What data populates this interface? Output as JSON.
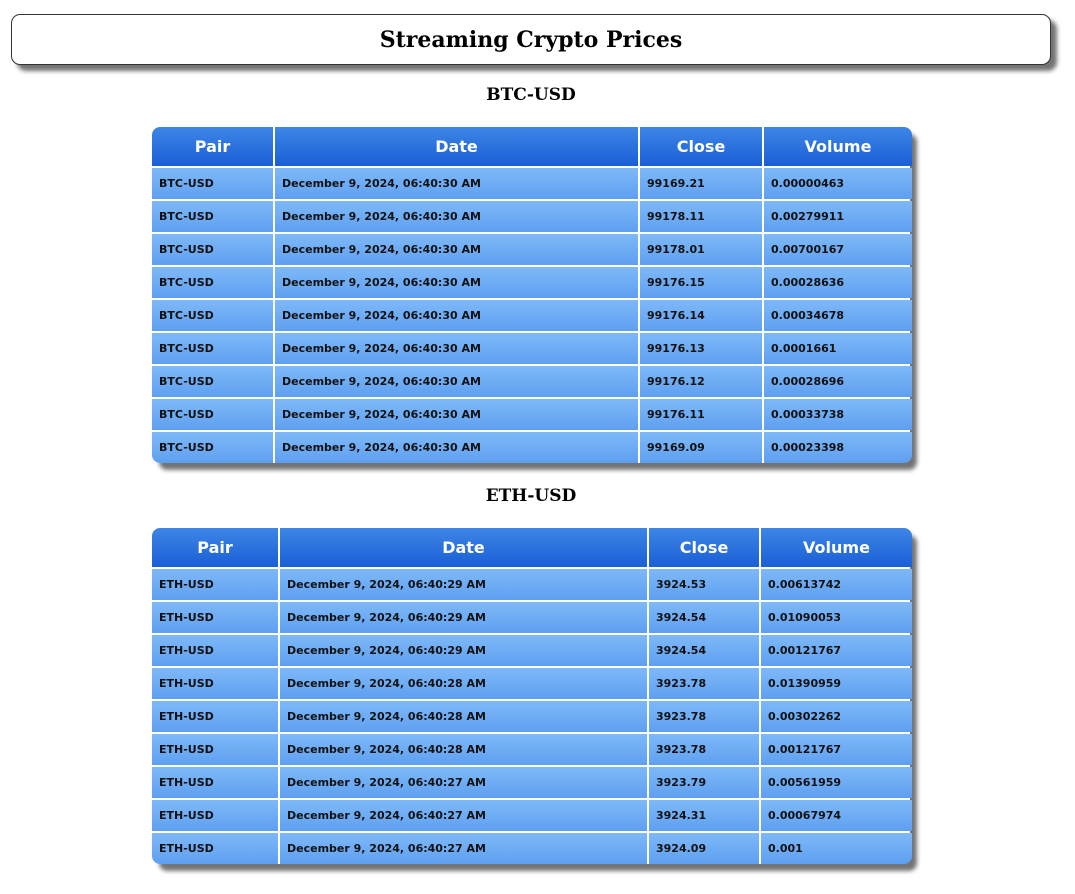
{
  "header": {
    "title": "Streaming Crypto Prices"
  },
  "columns": [
    "Pair",
    "Date",
    "Close",
    "Volume"
  ],
  "sections": [
    {
      "title": "BTC-USD",
      "rows": [
        [
          "BTC-USD",
          "December 9, 2024, 06:40:30 AM",
          "99169.21",
          "0.00000463"
        ],
        [
          "BTC-USD",
          "December 9, 2024, 06:40:30 AM",
          "99178.11",
          "0.00279911"
        ],
        [
          "BTC-USD",
          "December 9, 2024, 06:40:30 AM",
          "99178.01",
          "0.00700167"
        ],
        [
          "BTC-USD",
          "December 9, 2024, 06:40:30 AM",
          "99176.15",
          "0.00028636"
        ],
        [
          "BTC-USD",
          "December 9, 2024, 06:40:30 AM",
          "99176.14",
          "0.00034678"
        ],
        [
          "BTC-USD",
          "December 9, 2024, 06:40:30 AM",
          "99176.13",
          "0.0001661"
        ],
        [
          "BTC-USD",
          "December 9, 2024, 06:40:30 AM",
          "99176.12",
          "0.00028696"
        ],
        [
          "BTC-USD",
          "December 9, 2024, 06:40:30 AM",
          "99176.11",
          "0.00033738"
        ],
        [
          "BTC-USD",
          "December 9, 2024, 06:40:30 AM",
          "99169.09",
          "0.00023398"
        ]
      ]
    },
    {
      "title": "ETH-USD",
      "rows": [
        [
          "ETH-USD",
          "December 9, 2024, 06:40:29 AM",
          "3924.53",
          "0.00613742"
        ],
        [
          "ETH-USD",
          "December 9, 2024, 06:40:29 AM",
          "3924.54",
          "0.01090053"
        ],
        [
          "ETH-USD",
          "December 9, 2024, 06:40:29 AM",
          "3924.54",
          "0.00121767"
        ],
        [
          "ETH-USD",
          "December 9, 2024, 06:40:28 AM",
          "3923.78",
          "0.01390959"
        ],
        [
          "ETH-USD",
          "December 9, 2024, 06:40:28 AM",
          "3923.78",
          "0.00302262"
        ],
        [
          "ETH-USD",
          "December 9, 2024, 06:40:28 AM",
          "3923.78",
          "0.00121767"
        ],
        [
          "ETH-USD",
          "December 9, 2024, 06:40:27 AM",
          "3923.79",
          "0.00561959"
        ],
        [
          "ETH-USD",
          "December 9, 2024, 06:40:27 AM",
          "3924.31",
          "0.00067974"
        ],
        [
          "ETH-USD",
          "December 9, 2024, 06:40:27 AM",
          "3924.09",
          "0.001"
        ]
      ]
    }
  ]
}
